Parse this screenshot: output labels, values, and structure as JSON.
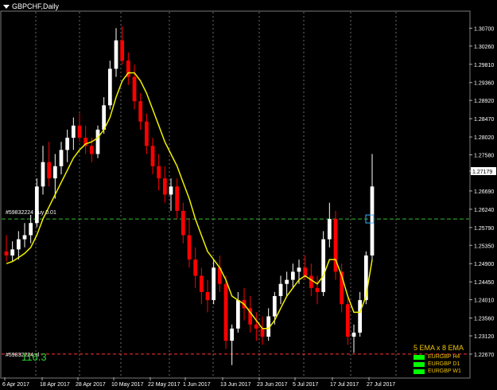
{
  "header": {
    "title": "GBPCHF,Daily"
  },
  "labels": {
    "buy_line": "#59832224 buy 0.01",
    "sl_line": "#59832224 sl",
    "big_value": "116.3"
  },
  "current_price": "1.27179",
  "legend": {
    "title": "5 EMA x 8 EMA",
    "items": [
      "EURGBP H4",
      "EURGBP D1",
      "EURGBP W1"
    ]
  },
  "colors": {
    "bull": "#ffffff",
    "bear": "#ff0000",
    "ema": "#f0f000",
    "buy_line": "#33bb33",
    "sl_line": "#ff3333",
    "legend_swatch": "#00ff00",
    "marker": "#3ab0ff"
  },
  "chart_data": {
    "type": "candlestick",
    "symbol": "GBPCHF",
    "timeframe": "Daily",
    "ylim": [
      1.221,
      1.311
    ],
    "y_ticks": [
      "1.30700",
      "1.30260",
      "1.29810",
      "1.29360",
      "1.28920",
      "1.28470",
      "1.28020",
      "1.27580",
      "1.27179",
      "1.26690",
      "1.26240",
      "1.25790",
      "1.25350",
      "1.24900",
      "1.24450",
      "1.24010",
      "1.23560",
      "1.23120",
      "1.22670"
    ],
    "x_labels": [
      "6 Apr 2017",
      "18 Apr 2017",
      "28 Apr 2017",
      "10 May 2017",
      "22 May 2017",
      "1 Jun 2017",
      "13 Jun 2017",
      "23 Jun 2017",
      "5 Jul 2017",
      "17 Jul 2017",
      "27 Jul 2017"
    ],
    "buy_price": 1.26,
    "sl_price": 1.2267,
    "series": [
      {
        "name": "ohlc",
        "candles": [
          [
            1.252,
            1.256,
            1.2495,
            1.251
          ],
          [
            1.251,
            1.2545,
            1.2495,
            1.2525
          ],
          [
            1.2525,
            1.257,
            1.25,
            1.255
          ],
          [
            1.255,
            1.259,
            1.253,
            1.256
          ],
          [
            1.256,
            1.261,
            1.254,
            1.259
          ],
          [
            1.259,
            1.27,
            1.258,
            1.268
          ],
          [
            1.268,
            1.278,
            1.266,
            1.274
          ],
          [
            1.274,
            1.279,
            1.268,
            1.27
          ],
          [
            1.27,
            1.276,
            1.265,
            1.273
          ],
          [
            1.273,
            1.279,
            1.271,
            1.277
          ],
          [
            1.277,
            1.282,
            1.274,
            1.28
          ],
          [
            1.28,
            1.285,
            1.277,
            1.283
          ],
          [
            1.283,
            1.286,
            1.279,
            1.28
          ],
          [
            1.28,
            1.283,
            1.276,
            1.278
          ],
          [
            1.278,
            1.28,
            1.274,
            1.276
          ],
          [
            1.276,
            1.283,
            1.275,
            1.282
          ],
          [
            1.282,
            1.29,
            1.281,
            1.288
          ],
          [
            1.288,
            1.299,
            1.287,
            1.297
          ],
          [
            1.297,
            1.307,
            1.295,
            1.304
          ],
          [
            1.304,
            1.3075,
            1.298,
            1.299
          ],
          [
            1.299,
            1.301,
            1.293,
            1.295
          ],
          [
            1.295,
            1.298,
            1.287,
            1.289
          ],
          [
            1.289,
            1.291,
            1.282,
            1.284
          ],
          [
            1.284,
            1.286,
            1.276,
            1.278
          ],
          [
            1.278,
            1.28,
            1.271,
            1.273
          ],
          [
            1.273,
            1.276,
            1.267,
            1.27
          ],
          [
            1.27,
            1.273,
            1.264,
            1.266
          ],
          [
            1.266,
            1.27,
            1.262,
            1.268
          ],
          [
            1.268,
            1.27,
            1.26,
            1.262
          ],
          [
            1.262,
            1.264,
            1.254,
            1.256
          ],
          [
            1.256,
            1.26,
            1.248,
            1.25
          ],
          [
            1.25,
            1.253,
            1.243,
            1.246
          ],
          [
            1.246,
            1.248,
            1.239,
            1.242
          ],
          [
            1.242,
            1.245,
            1.237,
            1.24
          ],
          [
            1.24,
            1.25,
            1.239,
            1.248
          ],
          [
            1.248,
            1.251,
            1.242,
            1.244
          ],
          [
            1.244,
            1.246,
            1.228,
            1.23
          ],
          [
            1.23,
            1.234,
            1.224,
            1.233
          ],
          [
            1.233,
            1.242,
            1.232,
            1.24
          ],
          [
            1.24,
            1.243,
            1.235,
            1.238
          ],
          [
            1.238,
            1.241,
            1.232,
            1.234
          ],
          [
            1.234,
            1.237,
            1.23,
            1.233
          ],
          [
            1.233,
            1.236,
            1.229,
            1.231
          ],
          [
            1.231,
            1.238,
            1.23,
            1.236
          ],
          [
            1.236,
            1.242,
            1.234,
            1.241
          ],
          [
            1.241,
            1.246,
            1.239,
            1.244
          ],
          [
            1.244,
            1.247,
            1.241,
            1.245
          ],
          [
            1.245,
            1.249,
            1.243,
            1.247
          ],
          [
            1.247,
            1.25,
            1.244,
            1.248
          ],
          [
            1.248,
            1.251,
            1.245,
            1.246
          ],
          [
            1.246,
            1.249,
            1.241,
            1.243
          ],
          [
            1.243,
            1.246,
            1.239,
            1.242
          ],
          [
            1.242,
            1.257,
            1.241,
            1.255
          ],
          [
            1.255,
            1.264,
            1.253,
            1.26
          ],
          [
            1.26,
            1.262,
            1.245,
            1.247
          ],
          [
            1.247,
            1.249,
            1.237,
            1.239
          ],
          [
            1.239,
            1.241,
            1.229,
            1.231
          ],
          [
            1.231,
            1.234,
            1.227,
            1.232
          ],
          [
            1.232,
            1.242,
            1.231,
            1.24
          ],
          [
            1.24,
            1.252,
            1.239,
            1.251
          ],
          [
            1.251,
            1.276,
            1.25,
            1.268
          ]
        ]
      },
      {
        "name": "EMA",
        "values": [
          1.249,
          1.2495,
          1.2505,
          1.2515,
          1.253,
          1.256,
          1.26,
          1.263,
          1.266,
          1.269,
          1.272,
          1.275,
          1.277,
          1.2785,
          1.279,
          1.28,
          1.282,
          1.285,
          1.29,
          1.294,
          1.296,
          1.296,
          1.294,
          1.291,
          1.287,
          1.283,
          1.279,
          1.276,
          1.273,
          1.269,
          1.265,
          1.26,
          1.256,
          1.252,
          1.25,
          1.248,
          1.245,
          1.241,
          1.24,
          1.239,
          1.237,
          1.235,
          1.233,
          1.233,
          1.235,
          1.238,
          1.241,
          1.243,
          1.245,
          1.246,
          1.245,
          1.244,
          1.246,
          1.25,
          1.25,
          1.246,
          1.241,
          1.237,
          1.237,
          1.241,
          1.25
        ]
      }
    ]
  }
}
